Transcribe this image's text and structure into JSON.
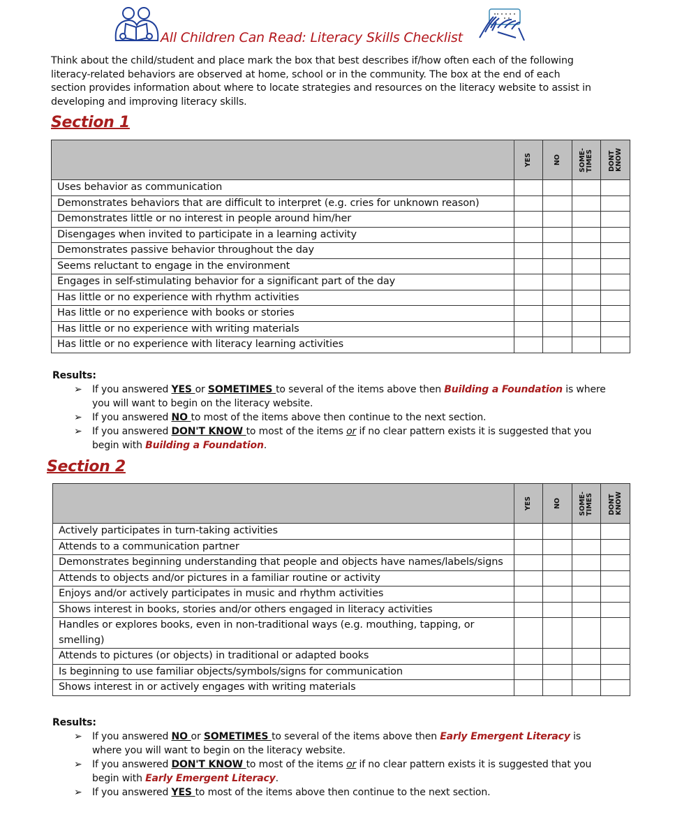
{
  "header": {
    "title": "All Children Can Read: Literacy Skills Checklist",
    "left_icon": "children-reading-icon",
    "right_icon": "braille-reading-hands-icon"
  },
  "intro": "Think about the child/student and place mark the box that best describes if/how often each of the following literacy-related behaviors are observed at home, school or in the community. The box at the end of each section provides information about where to locate strategies and resources on the literacy website to assist in developing and improving literacy skills.",
  "columns": [
    "YES",
    "NO",
    "SOME-\nTIMES",
    "DONT\nKNOW"
  ],
  "sections": [
    {
      "title": "Section 1",
      "items": [
        "Uses behavior as communication",
        "Demonstrates behaviors that are difficult to interpret (e.g. cries for unknown reason)",
        "Demonstrates little or no interest in people around him/her",
        "Disengages when invited to participate in a learning activity",
        "Demonstrates passive behavior throughout the day",
        "Seems reluctant to engage in the environment",
        "Engages in self-stimulating behavior for a significant part of the day",
        "Has little or no experience with rhythm activities",
        "Has little or no experience with books or stories",
        "Has little or no experience with writing materials",
        "Has little or no experience with literacy learning activities"
      ],
      "results_label": "Results:",
      "results": [
        [
          {
            "t": "If you answered "
          },
          {
            "t": "YES ",
            "s": "kw"
          },
          {
            "t": "or "
          },
          {
            "t": "SOMETIMES ",
            "s": "kw"
          },
          {
            "t": "to several of the items above then "
          },
          {
            "t": "Building a Foundation",
            "s": "link-red"
          },
          {
            "t": " is where you will want to begin on the literacy website."
          }
        ],
        [
          {
            "t": "If you answered "
          },
          {
            "t": "NO ",
            "s": "kw"
          },
          {
            "t": "to most of the items above then continue to the next section."
          }
        ],
        [
          {
            "t": "If you answered "
          },
          {
            "t": "DON'T KNOW ",
            "s": "kw"
          },
          {
            "t": "to most of the items "
          },
          {
            "t": "or",
            "s": "em-u"
          },
          {
            "t": " if no clear pattern exists it is suggested that you begin with "
          },
          {
            "t": "Building a Foundation",
            "s": "link-red"
          },
          {
            "t": "."
          }
        ]
      ]
    },
    {
      "title": "Section 2",
      "items": [
        "Actively participates in turn-taking activities",
        "Attends to a communication partner",
        "Demonstrates beginning understanding that people and objects have names/labels/signs",
        "Attends to objects and/or pictures in a familiar routine or activity",
        "Enjoys and/or actively participates in music and rhythm activities",
        "Shows interest in books, stories and/or others engaged in literacy  activities",
        "Handles or explores books, even in non-traditional ways (e.g. mouthing, tapping, or smelling)",
        "Attends to pictures (or objects) in traditional or adapted books",
        "Is beginning to use familiar objects/symbols/signs for communication",
        "Shows interest in or actively engages with writing materials"
      ],
      "results_label": "Results:",
      "results": [
        [
          {
            "t": "If you answered "
          },
          {
            "t": "NO ",
            "s": "kw"
          },
          {
            "t": "or "
          },
          {
            "t": "SOMETIMES ",
            "s": "kw"
          },
          {
            "t": "to several of the items above then "
          },
          {
            "t": "Early Emergent Literacy",
            "s": "link-red"
          },
          {
            "t": " is where you will want to begin on the literacy website."
          }
        ],
        [
          {
            "t": "If you answered "
          },
          {
            "t": "DON'T KNOW ",
            "s": "kw"
          },
          {
            "t": "to most of the items "
          },
          {
            "t": "or",
            "s": "em-u"
          },
          {
            "t": " if no clear pattern exists it is suggested that you begin with "
          },
          {
            "t": "Early Emergent Literacy",
            "s": "link-red"
          },
          {
            "t": "."
          }
        ],
        [
          {
            "t": "If you answered "
          },
          {
            "t": "YES ",
            "s": "kw"
          },
          {
            "t": "to most of the items above then continue to the next section."
          }
        ]
      ]
    }
  ],
  "colors": {
    "title_red": "#b2161b",
    "section_red": "#a81d1d",
    "header_gray": "#c0c0c0",
    "icon_blue": "#1e3f9a"
  }
}
